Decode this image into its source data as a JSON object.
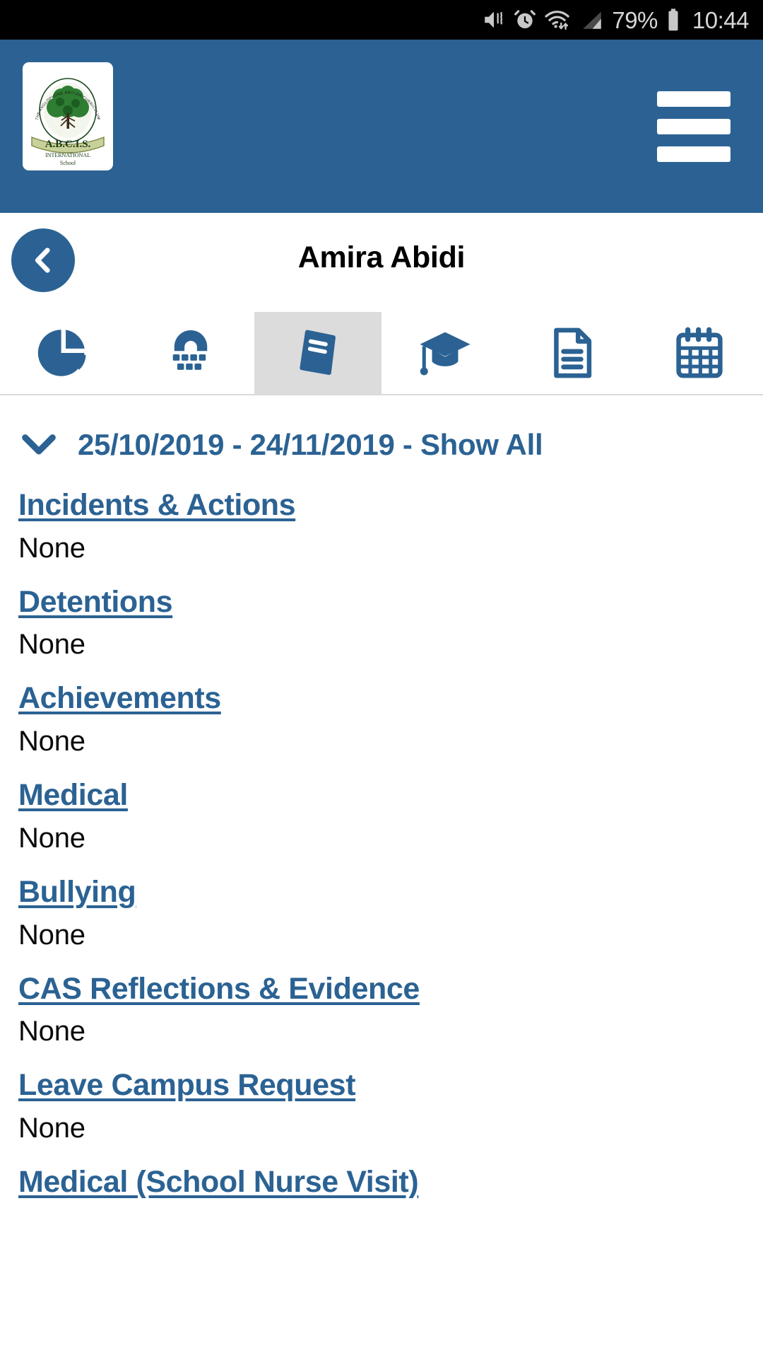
{
  "statusbar": {
    "battery_percent": "79%",
    "clock": "10:44",
    "icons": [
      "mute-vibrate-icon",
      "alarm-icon",
      "wifi-icon",
      "signal-icon",
      "battery-icon"
    ]
  },
  "appbar": {
    "logo": {
      "arc_text": "THE ANGLOPHONE BRITISH CURRICULUM",
      "acronym": "A.B.C.I.S.",
      "sub_line1": "INTERNATIONAL",
      "sub_line2": "School"
    },
    "menu_label": "hamburger-menu",
    "background_color": "#2b6293"
  },
  "header": {
    "title": "Amira Abidi",
    "back_label": "Back"
  },
  "tabs": [
    {
      "icon": "pie-chart-icon",
      "name": "tab-summary",
      "selected": false
    },
    {
      "icon": "abacus-icon",
      "name": "tab-attendance",
      "selected": false
    },
    {
      "icon": "book-icon",
      "name": "tab-behaviour",
      "selected": true
    },
    {
      "icon": "graduation-cap-icon",
      "name": "tab-academic",
      "selected": false
    },
    {
      "icon": "document-icon",
      "name": "tab-reports",
      "selected": false
    },
    {
      "icon": "calendar-icon",
      "name": "tab-timetable",
      "selected": false
    }
  ],
  "filter": {
    "chevron": "chevron-down-icon",
    "label": "25/10/2019 - 24/11/2019 - Show All"
  },
  "items": [
    {
      "label": "Incidents & Actions",
      "value": "None"
    },
    {
      "label": "Detentions",
      "value": "None"
    },
    {
      "label": "Achievements",
      "value": "None"
    },
    {
      "label": "Medical",
      "value": "None"
    },
    {
      "label": "Bullying",
      "value": "None"
    },
    {
      "label": "CAS Reflections & Evidence",
      "value": "None"
    },
    {
      "label": "Leave Campus Request",
      "value": "None"
    },
    {
      "label": "Medical (School Nurse Visit)",
      "value": ""
    }
  ],
  "colors": {
    "brand_blue": "#2b6293",
    "link_blue": "#2b6293",
    "selected_tab_bg": "#dcdcdc",
    "statusbar_bg": "#000000"
  }
}
